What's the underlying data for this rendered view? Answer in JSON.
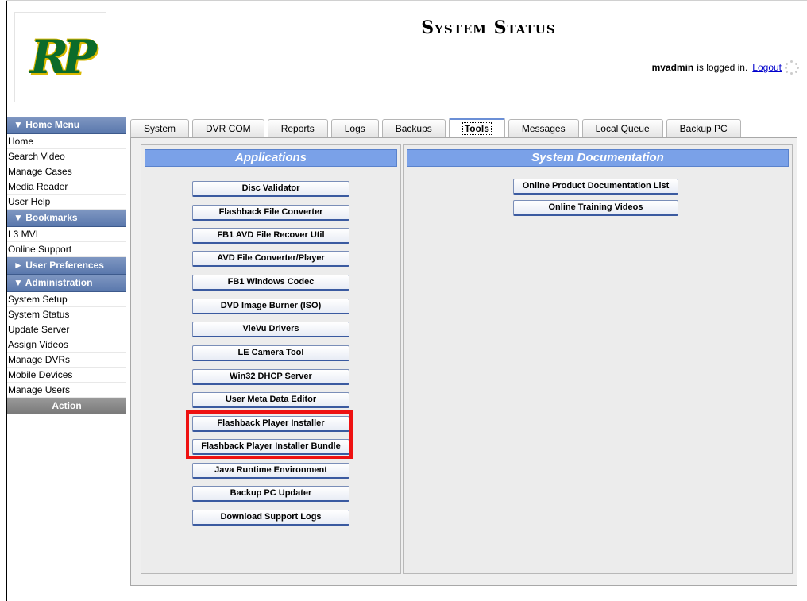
{
  "logo": {
    "text": "RP"
  },
  "header": {
    "title": "System Status",
    "username": "mvadmin",
    "logged_in_text": "is logged in.",
    "logout_label": "Logout"
  },
  "sidebar": {
    "home_menu": {
      "header": "▼  Home Menu",
      "items": [
        "Home",
        "Search Video",
        "Manage Cases",
        "Media Reader",
        "User Help"
      ]
    },
    "bookmarks": {
      "header": "▼  Bookmarks",
      "items": [
        "L3 MVI",
        "Online Support"
      ]
    },
    "user_preferences": {
      "header": "►  User Preferences"
    },
    "administration": {
      "header": "▼  Administration",
      "items": [
        "System Setup",
        "System Status",
        "Update Server",
        "Assign Videos",
        "Manage DVRs",
        "Mobile Devices",
        "Manage Users"
      ]
    },
    "action_label": "Action"
  },
  "tabs": [
    {
      "label": "System",
      "active": false
    },
    {
      "label": "DVR COM",
      "active": false
    },
    {
      "label": "Reports",
      "active": false
    },
    {
      "label": "Logs",
      "active": false
    },
    {
      "label": "Backups",
      "active": false
    },
    {
      "label": "Tools",
      "active": true
    },
    {
      "label": "Messages",
      "active": false
    },
    {
      "label": "Local Queue",
      "active": false
    },
    {
      "label": "Backup PC",
      "active": false
    }
  ],
  "applications": {
    "header": "Applications",
    "buttons": [
      "Disc Validator",
      "Flashback File Converter",
      "FB1 AVD File Recover Util",
      "AVD File Converter/Player",
      "FB1 Windows Codec",
      "DVD Image Burner (ISO)",
      "VieVu Drivers",
      "LE Camera Tool",
      "Win32 DHCP Server",
      "User Meta Data Editor",
      "Flashback Player Installer",
      "Flashback Player Installer Bundle",
      "Java Runtime Environment",
      "Backup PC Updater",
      "Download Support Logs"
    ]
  },
  "documentation": {
    "header": "System Documentation",
    "buttons": [
      "Online Product Documentation List",
      "Online Training Videos"
    ]
  },
  "colors": {
    "accent": "#7aa1e8",
    "sidebar": "#5a78ad",
    "highlight": "#ee1111",
    "logo": "#0b6b2a"
  }
}
